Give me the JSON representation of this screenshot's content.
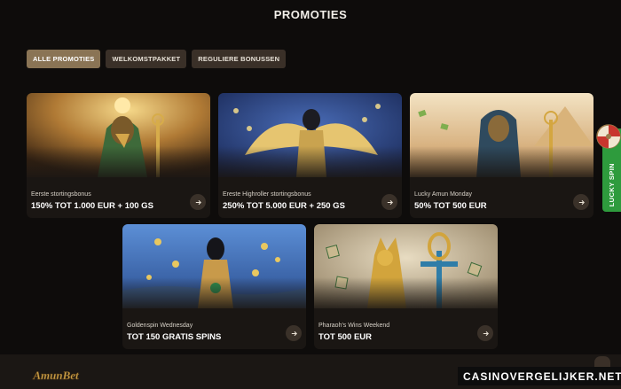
{
  "page": {
    "title": "PROMOTIES"
  },
  "tabs": [
    {
      "label": "ALLE PROMOTIES",
      "active": true
    },
    {
      "label": "WELKOMSTPAKKET",
      "active": false
    },
    {
      "label": "REGULIERE BONUSSEN",
      "active": false
    }
  ],
  "promotions": [
    {
      "subtitle": "Eerste stortingsbonus",
      "headline": "150% TOT 1.000 EUR + 100 GS",
      "icon": "arrow-right-icon"
    },
    {
      "subtitle": "Ereste Highroller stortingsbonus",
      "headline": "250% TOT 5.000 EUR + 250 GS",
      "icon": "arrow-right-icon"
    },
    {
      "subtitle": "Lucky Amun Monday",
      "headline": "50% TOT 500 EUR",
      "icon": "arrow-right-icon"
    },
    {
      "subtitle": "Goldenspin Wednesday",
      "headline": "TOT 150 GRATIS SPINS",
      "icon": "arrow-right-icon"
    },
    {
      "subtitle": "Pharaoh's Wins Weekend",
      "headline": "TOT 500 EUR",
      "icon": "arrow-right-icon"
    }
  ],
  "side_widget": {
    "label": "LUCKY SPIN",
    "color": "#2e9b3d"
  },
  "footer": {
    "logo_text": "AmunBet",
    "watermark": "CASINOVERGELIJKER.NET"
  },
  "colors": {
    "background": "#0e0c0b",
    "tab_active": "#8a7455",
    "tab_inactive": "#3a3028",
    "card": "#1a1613"
  }
}
